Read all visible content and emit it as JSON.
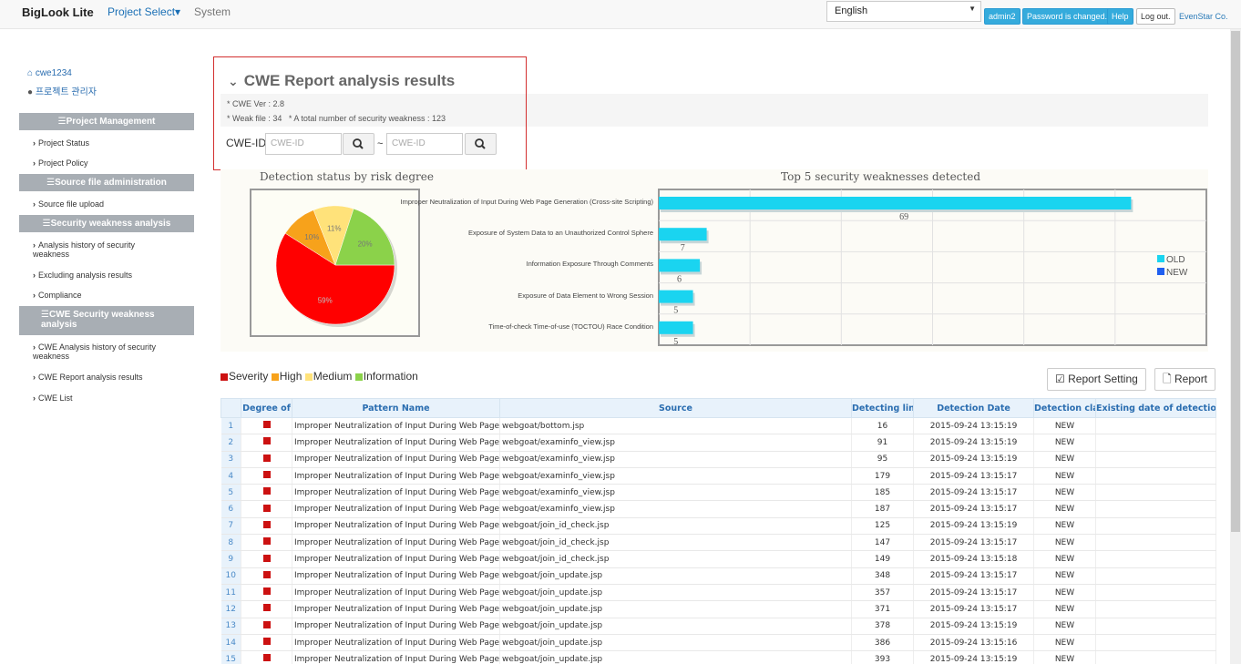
{
  "nav": {
    "brand": "BigLook Lite",
    "project_select": "Project Select▾",
    "system": "System",
    "language": "English",
    "user_btn": "admin2",
    "password_btn": "Password is changed.",
    "help_btn": "Help",
    "logout_btn": "Log out.",
    "company": "EvenStar Co."
  },
  "sidebar": {
    "user_id": "cwe1234",
    "role": "프로젝트 관리자",
    "sections": {
      "project_management": "Project Management",
      "source_file_admin": "Source file administration",
      "security_weakness": "Security weakness analysis",
      "cwe_security": "CWE Security weakness analysis"
    },
    "items": {
      "project_status": "Project Status",
      "project_policy": "Project Policy",
      "source_file_upload": "Source file upload",
      "analysis_history": "Analysis history of security weakness",
      "excluding_results": "Excluding analysis results",
      "compliance": "Compliance",
      "cwe_history": "CWE Analysis history of security weakness",
      "cwe_report": "CWE Report analysis results",
      "cwe_list": "CWE List"
    }
  },
  "report": {
    "title": "CWE Report analysis results",
    "cwe_ver": "* CWE Ver : 2.8",
    "weak_file": "* Weak file : 34",
    "total_weakness": "* A total number of security weakness : 123",
    "cwe_id_label": "CWE-ID",
    "cwe_id_placeholder": "CWE-ID",
    "tilde": "~"
  },
  "chart_data": [
    {
      "type": "pie",
      "title": "Detection status by risk degree",
      "labels": [
        "Severity",
        "High",
        "Medium",
        "Information"
      ],
      "values": [
        59,
        10,
        11,
        20
      ],
      "value_labels": [
        "59%",
        "10%",
        "11%",
        "20%"
      ],
      "colors": [
        "#ff0000",
        "#f7a21b",
        "#ffe27a",
        "#8bd24a"
      ]
    },
    {
      "type": "bar",
      "orientation": "horizontal",
      "title": "Top 5 security weaknesses detected",
      "categories": [
        "Improper Neutralization of Input During Web Page Generation (Cross-site Scripting)",
        "Exposure of System Data to an Unauthorized Control Sphere",
        "Information Exposure Through Comments",
        "Exposure of Data Element to Wrong Session",
        "Time-of-check Time-of-use (TOCTOU) Race Condition"
      ],
      "series": [
        {
          "name": "OLD",
          "values": [
            69,
            7,
            6,
            5,
            5
          ],
          "color": "#1ad4f0"
        },
        {
          "name": "NEW",
          "values": [
            0,
            0,
            0,
            0,
            0
          ],
          "color": "#1f5ff0"
        }
      ],
      "xlim": [
        0,
        80
      ],
      "legend": "right"
    }
  ],
  "legend": {
    "severity": "Severity",
    "high": "High",
    "medium": "Medium",
    "information": "Information"
  },
  "buttons": {
    "report_setting": "Report Setting",
    "report": "Report"
  },
  "table": {
    "headers": [
      "",
      "Degree of",
      "Pattern Name",
      "Source",
      "Detecting lin",
      "Detection Date",
      "Detection cla",
      "Existing date of detection"
    ],
    "pattern": "Improper Neutralization of Input During Web Page Generation",
    "rows": [
      {
        "n": "1",
        "source": "webgoat/bottom.jsp",
        "line": "16",
        "date": "2015-09-24 13:15:19",
        "cls": "NEW"
      },
      {
        "n": "2",
        "source": "webgoat/examinfo_view.jsp",
        "line": "91",
        "date": "2015-09-24 13:15:19",
        "cls": "NEW"
      },
      {
        "n": "3",
        "source": "webgoat/examinfo_view.jsp",
        "line": "95",
        "date": "2015-09-24 13:15:19",
        "cls": "NEW"
      },
      {
        "n": "4",
        "source": "webgoat/examinfo_view.jsp",
        "line": "179",
        "date": "2015-09-24 13:15:17",
        "cls": "NEW"
      },
      {
        "n": "5",
        "source": "webgoat/examinfo_view.jsp",
        "line": "185",
        "date": "2015-09-24 13:15:17",
        "cls": "NEW"
      },
      {
        "n": "6",
        "source": "webgoat/examinfo_view.jsp",
        "line": "187",
        "date": "2015-09-24 13:15:17",
        "cls": "NEW"
      },
      {
        "n": "7",
        "source": "webgoat/join_id_check.jsp",
        "line": "125",
        "date": "2015-09-24 13:15:19",
        "cls": "NEW"
      },
      {
        "n": "8",
        "source": "webgoat/join_id_check.jsp",
        "line": "147",
        "date": "2015-09-24 13:15:17",
        "cls": "NEW"
      },
      {
        "n": "9",
        "source": "webgoat/join_id_check.jsp",
        "line": "149",
        "date": "2015-09-24 13:15:18",
        "cls": "NEW"
      },
      {
        "n": "10",
        "source": "webgoat/join_update.jsp",
        "line": "348",
        "date": "2015-09-24 13:15:17",
        "cls": "NEW"
      },
      {
        "n": "11",
        "source": "webgoat/join_update.jsp",
        "line": "357",
        "date": "2015-09-24 13:15:17",
        "cls": "NEW"
      },
      {
        "n": "12",
        "source": "webgoat/join_update.jsp",
        "line": "371",
        "date": "2015-09-24 13:15:17",
        "cls": "NEW"
      },
      {
        "n": "13",
        "source": "webgoat/join_update.jsp",
        "line": "378",
        "date": "2015-09-24 13:15:19",
        "cls": "NEW"
      },
      {
        "n": "14",
        "source": "webgoat/join_update.jsp",
        "line": "386",
        "date": "2015-09-24 13:15:16",
        "cls": "NEW"
      },
      {
        "n": "15",
        "source": "webgoat/join_update.jsp",
        "line": "393",
        "date": "2015-09-24 13:15:19",
        "cls": "NEW"
      }
    ]
  }
}
